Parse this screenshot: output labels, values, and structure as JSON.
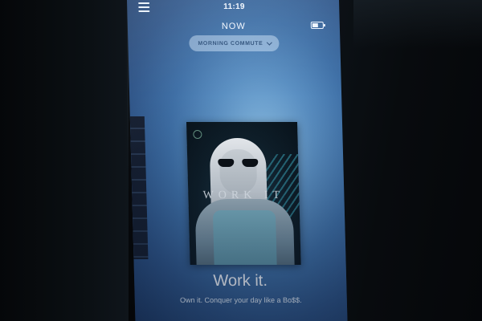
{
  "status_bar": {
    "time": "11:19",
    "menu_icon": "hamburger-menu-icon",
    "battery_icon": "battery-icon"
  },
  "header": {
    "title": "NOW",
    "playlist_selector": {
      "label": "MORNING COMMUTE",
      "icon": "chevron-down-icon"
    }
  },
  "now_playing": {
    "album_art_text": "WORK IT",
    "title": "Work it.",
    "subtitle": "Own it. Conquer your day like a Bo$$."
  },
  "colors": {
    "screen_glow": "#8cc0e6",
    "screen_base": "#3d6ea5",
    "text": "#f5f9ff"
  }
}
